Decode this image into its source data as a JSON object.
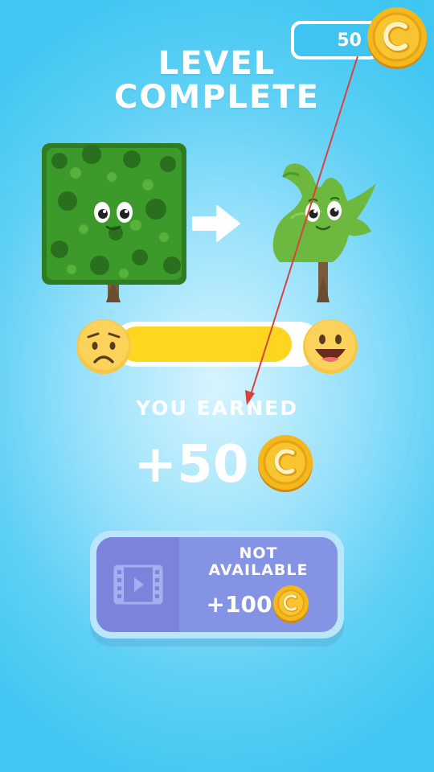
{
  "header": {
    "coin_balance": "50",
    "title_line1": "LEVEL",
    "title_line2": "COMPLETE"
  },
  "transformation": {
    "before": "square-bush",
    "after": "leaf-shaped-bush",
    "arrow": "right-arrow-icon"
  },
  "progress": {
    "fill_fraction": 0.88,
    "start_emoji": "worried-face-icon",
    "end_emoji": "grinning-face-icon"
  },
  "earned": {
    "label": "YOU EARNED",
    "amount": "+50"
  },
  "reward_button": {
    "icon": "film-video-icon",
    "status_line1": "NOT",
    "status_line2": "AVAILABLE",
    "amount": "+100"
  },
  "colors": {
    "background": "#4fcbf3",
    "coin": "#f2b21a",
    "progress_fill": "#ffd61f",
    "button": "#8493e4",
    "annotation_arrow": "#d9413f"
  }
}
